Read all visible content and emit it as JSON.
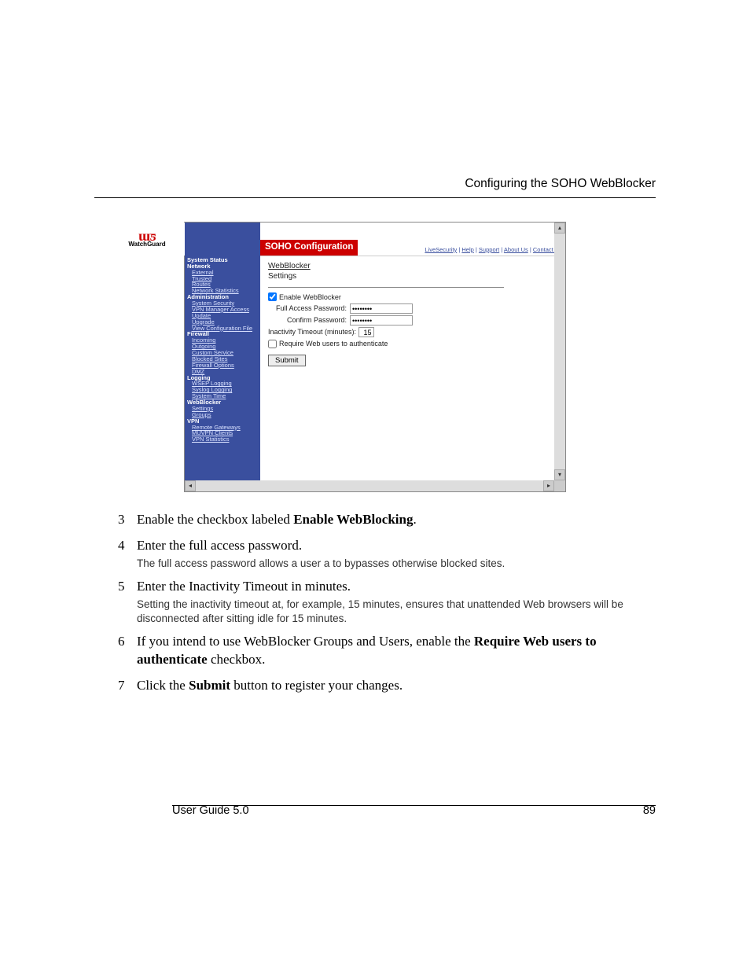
{
  "header": {
    "title": "Configuring the SOHO WebBlocker"
  },
  "screenshot": {
    "logo_text": "WatchGuard",
    "red_bar": "SOHO Configuration",
    "top_links": [
      "LiveSecurity",
      "Help",
      "Support",
      "About Us",
      "Contact Us"
    ],
    "sidebar": {
      "system_status": "System Status",
      "network": "Network",
      "network_items": [
        "External",
        "Trusted",
        "Routes",
        "Network Statistics"
      ],
      "administration": "Administration",
      "admin_items": [
        "System Security",
        "VPN Manager Access",
        "Update",
        "Upgrade",
        "View Configuration File"
      ],
      "firewall": "Firewall",
      "firewall_items": [
        "Incoming",
        "Outgoing",
        "Custom Service",
        "Blocked Sites",
        "Firewall Options",
        "DMZ"
      ],
      "logging": "Logging",
      "logging_items": [
        "WSEP Logging",
        "Syslog Logging",
        "System Time"
      ],
      "webblocker": "WebBlocker",
      "webblocker_items": [
        "Settings",
        "Groups"
      ],
      "vpn": "VPN",
      "vpn_items": [
        "Remote Gateways",
        "MUVPN Clients",
        "VPN Statistics"
      ]
    },
    "content": {
      "title_line1": "WebBlocker",
      "title_line2": "Settings",
      "enable_label": "Enable WebBlocker",
      "full_pw_label": "Full Access Password:",
      "confirm_pw_label": "Confirm Password:",
      "inactivity_label": "Inactivity Timeout (minutes):",
      "inactivity_value": "15",
      "require_label": "Require Web users to authenticate",
      "submit_label": "Submit",
      "pw_value": "••••••••"
    }
  },
  "steps": [
    {
      "num": "3",
      "text_pre": "Enable the checkbox labeled ",
      "text_bold": "Enable WebBlocking",
      "text_post": "."
    },
    {
      "num": "4",
      "text_full": "Enter the full access password.",
      "note": "The full access password allows a user a to bypasses otherwise blocked sites."
    },
    {
      "num": "5",
      "text_full": "Enter the Inactivity Timeout in minutes.",
      "note": "Setting the inactivity timeout at, for example, 15 minutes, ensures that unattended Web browsers will be disconnected after sitting idle for 15 minutes."
    },
    {
      "num": "6",
      "text_pre": "If you intend to use WebBlocker Groups and Users, enable the ",
      "text_bold": "Require Web users to authenticate",
      "text_post": " checkbox."
    },
    {
      "num": "7",
      "text_pre": "Click the ",
      "text_bold": "Submit",
      "text_post": " button to register your changes."
    }
  ],
  "footer": {
    "left": "User Guide 5.0",
    "right": "89"
  }
}
